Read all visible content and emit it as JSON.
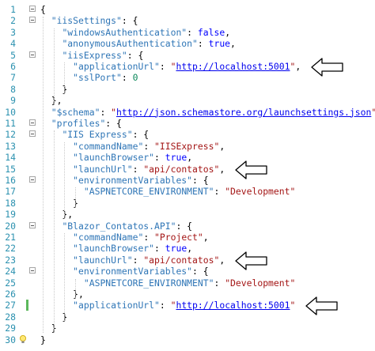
{
  "editor": {
    "lines": [
      {
        "num": "1",
        "tokens": [
          {
            "t": "p",
            "v": "{"
          }
        ]
      },
      {
        "num": "2",
        "tokens": [
          {
            "t": "p",
            "v": "  "
          },
          {
            "t": "key",
            "v": "\"iisSettings\""
          },
          {
            "t": "p",
            "v": ": {"
          }
        ]
      },
      {
        "num": "3",
        "tokens": [
          {
            "t": "p",
            "v": "    "
          },
          {
            "t": "key",
            "v": "\"windowsAuthentication\""
          },
          {
            "t": "p",
            "v": ": "
          },
          {
            "t": "kw",
            "v": "false"
          },
          {
            "t": "p",
            "v": ","
          }
        ]
      },
      {
        "num": "4",
        "tokens": [
          {
            "t": "p",
            "v": "    "
          },
          {
            "t": "key",
            "v": "\"anonymousAuthentication\""
          },
          {
            "t": "p",
            "v": ": "
          },
          {
            "t": "kw",
            "v": "true"
          },
          {
            "t": "p",
            "v": ","
          }
        ]
      },
      {
        "num": "5",
        "tokens": [
          {
            "t": "p",
            "v": "    "
          },
          {
            "t": "key",
            "v": "\"iisExpress\""
          },
          {
            "t": "p",
            "v": ": {"
          }
        ]
      },
      {
        "num": "6",
        "tokens": [
          {
            "t": "p",
            "v": "      "
          },
          {
            "t": "key",
            "v": "\"applicationUrl\""
          },
          {
            "t": "p",
            "v": ": "
          },
          {
            "t": "str",
            "v": "\""
          },
          {
            "t": "url",
            "v": "http://localhost:5001"
          },
          {
            "t": "str",
            "v": "\""
          },
          {
            "t": "p",
            "v": ","
          }
        ]
      },
      {
        "num": "7",
        "tokens": [
          {
            "t": "p",
            "v": "      "
          },
          {
            "t": "key",
            "v": "\"sslPort\""
          },
          {
            "t": "p",
            "v": ": "
          },
          {
            "t": "num",
            "v": "0"
          }
        ]
      },
      {
        "num": "8",
        "tokens": [
          {
            "t": "p",
            "v": "    }"
          }
        ]
      },
      {
        "num": "9",
        "tokens": [
          {
            "t": "p",
            "v": "  },"
          }
        ]
      },
      {
        "num": "10",
        "tokens": [
          {
            "t": "p",
            "v": "  "
          },
          {
            "t": "key",
            "v": "\"$schema\""
          },
          {
            "t": "p",
            "v": ": "
          },
          {
            "t": "str",
            "v": "\""
          },
          {
            "t": "url",
            "v": "http://json.schemastore.org/launchsettings.json"
          },
          {
            "t": "str",
            "v": "\""
          },
          {
            "t": "p",
            "v": ","
          }
        ]
      },
      {
        "num": "11",
        "tokens": [
          {
            "t": "p",
            "v": "  "
          },
          {
            "t": "key",
            "v": "\"profiles\""
          },
          {
            "t": "p",
            "v": ": {"
          }
        ]
      },
      {
        "num": "12",
        "tokens": [
          {
            "t": "p",
            "v": "    "
          },
          {
            "t": "key",
            "v": "\"IIS Express\""
          },
          {
            "t": "p",
            "v": ": {"
          }
        ]
      },
      {
        "num": "13",
        "tokens": [
          {
            "t": "p",
            "v": "      "
          },
          {
            "t": "key",
            "v": "\"commandName\""
          },
          {
            "t": "p",
            "v": ": "
          },
          {
            "t": "str",
            "v": "\"IISExpress\""
          },
          {
            "t": "p",
            "v": ","
          }
        ]
      },
      {
        "num": "14",
        "tokens": [
          {
            "t": "p",
            "v": "      "
          },
          {
            "t": "key",
            "v": "\"launchBrowser\""
          },
          {
            "t": "p",
            "v": ": "
          },
          {
            "t": "kw",
            "v": "true"
          },
          {
            "t": "p",
            "v": ","
          }
        ]
      },
      {
        "num": "15",
        "tokens": [
          {
            "t": "p",
            "v": "      "
          },
          {
            "t": "key",
            "v": "\"launchUrl\""
          },
          {
            "t": "p",
            "v": ": "
          },
          {
            "t": "str",
            "v": "\"api/contatos\""
          },
          {
            "t": "p",
            "v": ","
          }
        ]
      },
      {
        "num": "16",
        "tokens": [
          {
            "t": "p",
            "v": "      "
          },
          {
            "t": "key",
            "v": "\"environmentVariables\""
          },
          {
            "t": "p",
            "v": ": {"
          }
        ]
      },
      {
        "num": "17",
        "tokens": [
          {
            "t": "p",
            "v": "        "
          },
          {
            "t": "key",
            "v": "\"ASPNETCORE_ENVIRONMENT\""
          },
          {
            "t": "p",
            "v": ": "
          },
          {
            "t": "str",
            "v": "\"Development\""
          }
        ]
      },
      {
        "num": "18",
        "tokens": [
          {
            "t": "p",
            "v": "      }"
          }
        ]
      },
      {
        "num": "19",
        "tokens": [
          {
            "t": "p",
            "v": "    },"
          }
        ]
      },
      {
        "num": "20",
        "tokens": [
          {
            "t": "p",
            "v": "    "
          },
          {
            "t": "key",
            "v": "\"Blazor_Contatos.API\""
          },
          {
            "t": "p",
            "v": ": {"
          }
        ]
      },
      {
        "num": "21",
        "tokens": [
          {
            "t": "p",
            "v": "      "
          },
          {
            "t": "key",
            "v": "\"commandName\""
          },
          {
            "t": "p",
            "v": ": "
          },
          {
            "t": "str",
            "v": "\"Project\""
          },
          {
            "t": "p",
            "v": ","
          }
        ]
      },
      {
        "num": "22",
        "tokens": [
          {
            "t": "p",
            "v": "      "
          },
          {
            "t": "key",
            "v": "\"launchBrowser\""
          },
          {
            "t": "p",
            "v": ": "
          },
          {
            "t": "kw",
            "v": "true"
          },
          {
            "t": "p",
            "v": ","
          }
        ]
      },
      {
        "num": "23",
        "tokens": [
          {
            "t": "p",
            "v": "      "
          },
          {
            "t": "key",
            "v": "\"launchUrl\""
          },
          {
            "t": "p",
            "v": ": "
          },
          {
            "t": "str",
            "v": "\"api/contatos\""
          },
          {
            "t": "p",
            "v": ","
          }
        ]
      },
      {
        "num": "24",
        "tokens": [
          {
            "t": "p",
            "v": "      "
          },
          {
            "t": "key",
            "v": "\"environmentVariables\""
          },
          {
            "t": "p",
            "v": ": {"
          }
        ]
      },
      {
        "num": "25",
        "tokens": [
          {
            "t": "p",
            "v": "        "
          },
          {
            "t": "key",
            "v": "\"ASPNETCORE_ENVIRONMENT\""
          },
          {
            "t": "p",
            "v": ": "
          },
          {
            "t": "str",
            "v": "\"Development\""
          }
        ]
      },
      {
        "num": "26",
        "tokens": [
          {
            "t": "p",
            "v": "      },"
          }
        ]
      },
      {
        "num": "27",
        "tokens": [
          {
            "t": "p",
            "v": "      "
          },
          {
            "t": "key",
            "v": "\"applicationUrl\""
          },
          {
            "t": "p",
            "v": ": "
          },
          {
            "t": "str",
            "v": "\""
          },
          {
            "t": "url",
            "v": "http://localhost:5001"
          },
          {
            "t": "str",
            "v": "\""
          }
        ]
      },
      {
        "num": "28",
        "tokens": [
          {
            "t": "p",
            "v": "    }"
          }
        ]
      },
      {
        "num": "29",
        "tokens": [
          {
            "t": "p",
            "v": "  }"
          }
        ]
      },
      {
        "num": "30",
        "tokens": [
          {
            "t": "p",
            "v": "}"
          }
        ]
      }
    ],
    "fold_lines": [
      "1",
      "2",
      "5",
      "11",
      "12",
      "16",
      "20",
      "24"
    ],
    "arrow_lines": [
      "6",
      "15",
      "23",
      "27"
    ],
    "changed_lines": [
      "27"
    ],
    "lightbulb_line": "30",
    "colors": {
      "line_number": "#2b91af",
      "json_key": "#2e75b6",
      "string": "#a31515",
      "keyword": "#0000ff",
      "number": "#098658",
      "url": "#0000ee",
      "change_indicator": "#5cb85c"
    }
  }
}
